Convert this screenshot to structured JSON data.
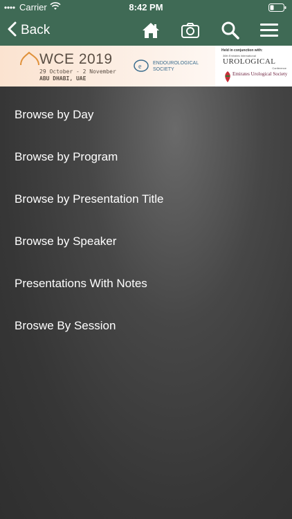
{
  "status_bar": {
    "carrier": "Carrier",
    "time": "8:42 PM"
  },
  "nav": {
    "back_label": "Back",
    "icons": [
      "home-icon",
      "camera-icon",
      "search-icon",
      "menu-icon"
    ]
  },
  "banner": {
    "title": "WCE 2019",
    "dates": "29 October - 2 November",
    "location": "ABU DHABI, UAE",
    "society": "ENDOUROLOGICAL SOCIETY",
    "conjunction": "Held in conjunction with:",
    "conf_sub": "36th Emirates International",
    "uro_title": "UROLOGICAL",
    "conference": "Conference",
    "uro_society": "Emirates Urological Society"
  },
  "menu": {
    "items": [
      "Browse by Day",
      "Browse by Program",
      "Browse by Presentation Title",
      "Browse by Speaker",
      "Presentations With Notes",
      "Broswe By Session"
    ]
  },
  "colors": {
    "header": "#3f6a55",
    "content_bg": "#3a3a3a",
    "text": "#ffffff"
  }
}
